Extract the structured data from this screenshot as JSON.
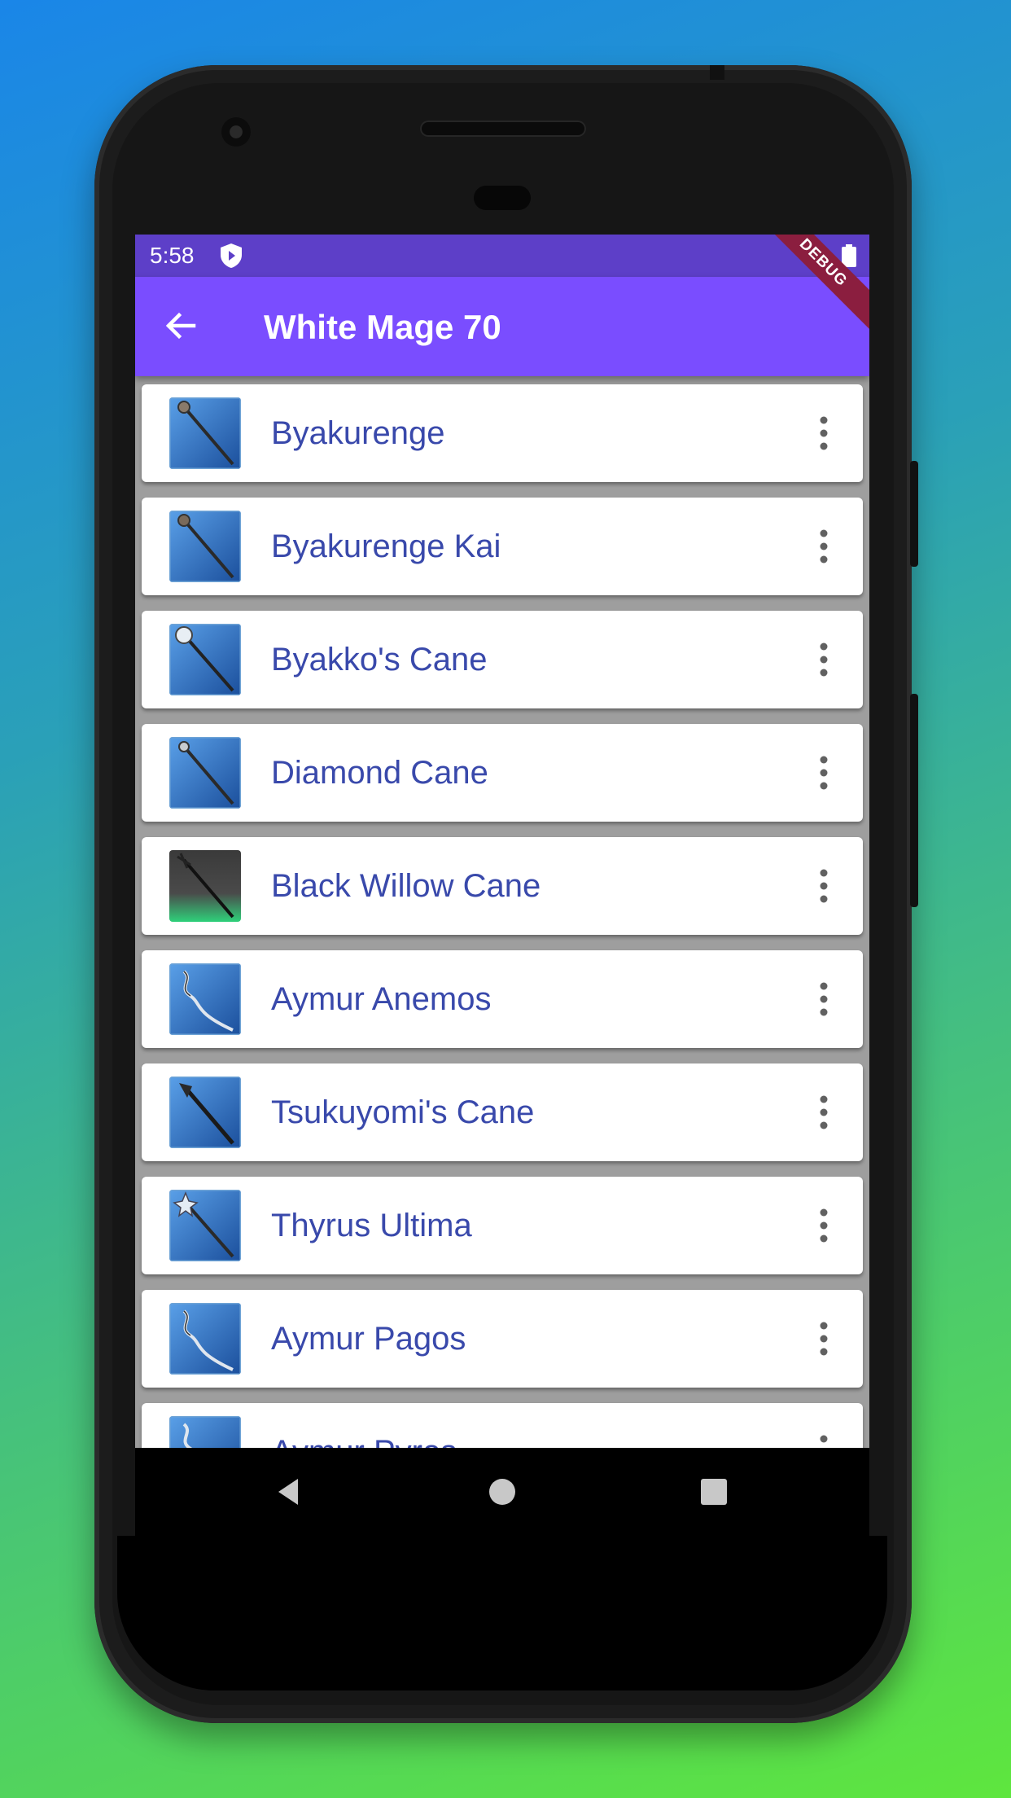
{
  "status_bar": {
    "time": "5:58",
    "debug_label": "DEBUG"
  },
  "app_bar": {
    "title": "White Mage 70"
  },
  "items": [
    {
      "label": "Byakurenge",
      "icon": "staff-icon"
    },
    {
      "label": "Byakurenge Kai",
      "icon": "staff-icon"
    },
    {
      "label": "Byakko's Cane",
      "icon": "staff-icon"
    },
    {
      "label": "Diamond Cane",
      "icon": "staff-icon"
    },
    {
      "label": "Black Willow Cane",
      "icon": "staff-icon"
    },
    {
      "label": "Aymur Anemos",
      "icon": "staff-icon"
    },
    {
      "label": "Tsukuyomi's Cane",
      "icon": "staff-icon"
    },
    {
      "label": "Thyrus Ultima",
      "icon": "staff-icon"
    },
    {
      "label": "Aymur Pagos",
      "icon": "staff-icon"
    },
    {
      "label": "Aymur Pyros",
      "icon": "staff-icon"
    }
  ],
  "colors": {
    "status_bar": "#5d3fc8",
    "app_bar": "#7a4dff",
    "item_text": "#3949ab",
    "thumb_blue": "#2a6ec9",
    "thumb_green": "#2fd07a",
    "debug_ribbon": "#8b1e3f"
  }
}
